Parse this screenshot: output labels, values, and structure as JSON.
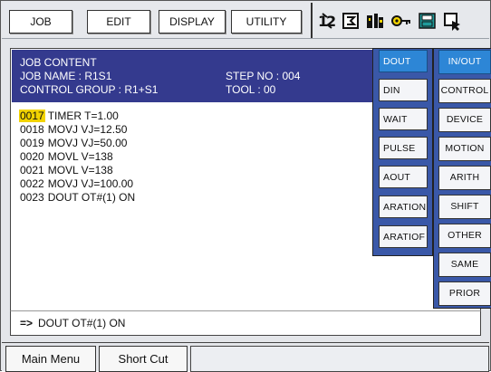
{
  "menu": [
    {
      "id": "job",
      "label": "JOB"
    },
    {
      "id": "edit",
      "label": "EDIT"
    },
    {
      "id": "display",
      "label": "DISPLAY"
    },
    {
      "id": "utility",
      "label": "UTILITY"
    }
  ],
  "status_icons": [
    {
      "name": "axis-1-2-icon"
    },
    {
      "name": "cycle-icon"
    },
    {
      "name": "operation-mode-icon"
    },
    {
      "name": "security-key-icon"
    },
    {
      "name": "save-icon"
    },
    {
      "name": "cursor-pointer-icon"
    }
  ],
  "job_content": {
    "title": "JOB CONTENT",
    "job_name_label": "JOB NAME : R1S1",
    "control_group_label": "CONTROL GROUP : R1+S1",
    "step_no_label": "STEP NO : 004",
    "tool_label": "TOOL : 00"
  },
  "program": [
    {
      "num": "0017",
      "text": "TIMER T=1.00",
      "selected": true
    },
    {
      "num": "0018",
      "text": "MOVJ VJ=12.50",
      "selected": false
    },
    {
      "num": "0019",
      "text": "MOVJ VJ=50.00",
      "selected": false
    },
    {
      "num": "0020",
      "text": "MOVL V=138",
      "selected": false
    },
    {
      "num": "0021",
      "text": "MOVL V=138",
      "selected": false
    },
    {
      "num": "0022",
      "text": "MOVJ VJ=100.00",
      "selected": false
    },
    {
      "num": "0023",
      "text": "DOUT OT#(1) ON",
      "selected": false
    }
  ],
  "io_palette": [
    "DOUT",
    "DIN",
    "WAIT",
    "PULSE",
    "AOUT",
    "ARATION",
    "ARATIOF"
  ],
  "category_palette": [
    "IN/OUT",
    "CONTROL",
    "DEVICE",
    "MOTION",
    "ARITH",
    "SHIFT",
    "OTHER",
    "SAME",
    "PRIOR"
  ],
  "command_line": {
    "arrow": "=>",
    "text": "DOUT OT#(1) ON"
  },
  "bottom": {
    "main_menu": "Main Menu",
    "short_cut": "Short Cut"
  },
  "colors": {
    "header_bg": "#343a8e",
    "palette_bg": "#3a58a8",
    "active_btn": "#2d86d6",
    "selected_line": "#f2d300"
  }
}
